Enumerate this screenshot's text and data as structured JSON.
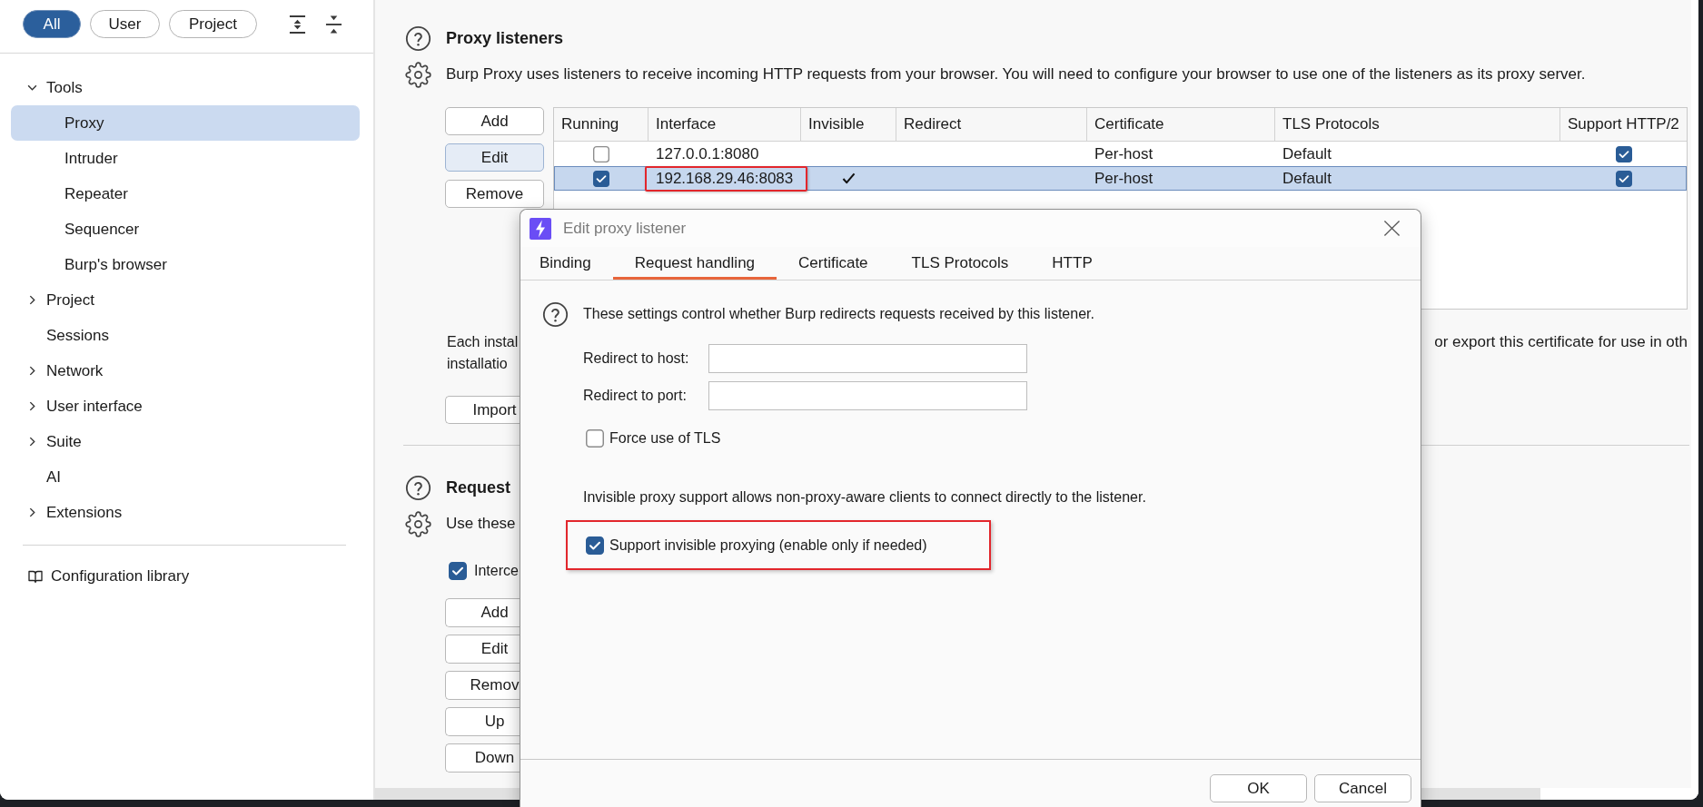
{
  "sidebar": {
    "filters": [
      {
        "label": "All",
        "selected": true
      },
      {
        "label": "User",
        "selected": false
      },
      {
        "label": "Project",
        "selected": false
      }
    ],
    "tree": [
      {
        "label": "Tools",
        "kind": "folder",
        "expanded": true,
        "selected": false,
        "children": [
          {
            "label": "Proxy",
            "selected": true
          },
          {
            "label": "Intruder",
            "selected": false
          },
          {
            "label": "Repeater",
            "selected": false
          },
          {
            "label": "Sequencer",
            "selected": false
          },
          {
            "label": "Burp's browser",
            "selected": false
          }
        ]
      },
      {
        "label": "Project",
        "kind": "folder",
        "expanded": false,
        "selected": false
      },
      {
        "label": "Sessions",
        "kind": "leaf",
        "selected": false
      },
      {
        "label": "Network",
        "kind": "folder",
        "expanded": false,
        "selected": false
      },
      {
        "label": "User interface",
        "kind": "folder",
        "expanded": false,
        "selected": false
      },
      {
        "label": "Suite",
        "kind": "folder",
        "expanded": false,
        "selected": false
      },
      {
        "label": "AI",
        "kind": "leaf",
        "selected": false
      },
      {
        "label": "Extensions",
        "kind": "folder",
        "expanded": false,
        "selected": false
      }
    ],
    "footer_link": "Configuration library"
  },
  "proxy_listeners": {
    "title": "Proxy listeners",
    "description": "Burp Proxy uses listeners to receive incoming HTTP requests from your browser. You will need to configure your browser to use one of the listeners as its proxy server.",
    "buttons": [
      {
        "label": "Add",
        "focused": false
      },
      {
        "label": "Edit",
        "focused": true
      },
      {
        "label": "Remove",
        "focused": false
      }
    ],
    "table": {
      "columns": [
        "Running",
        "Interface",
        "Invisible",
        "Redirect",
        "Certificate",
        "TLS Protocols",
        "Support HTTP/2"
      ],
      "rows": [
        {
          "running": false,
          "interface": "127.0.0.1:8080",
          "invisible": false,
          "certificate": "Per-host",
          "tls_protocols": "Default",
          "support_http2": true,
          "selected": false,
          "highlighted": false
        },
        {
          "running": true,
          "interface": "192.168.29.46:8083",
          "invisible": true,
          "certificate": "Per-host",
          "tls_protocols": "Default",
          "support_http2": true,
          "selected": true,
          "highlighted": true
        }
      ]
    }
  },
  "certificate_section": {
    "lines": [
      {
        "left": "Each instal",
        "right": "or export this certificate for use in oth"
      },
      {
        "left": "installatio"
      }
    ],
    "buttons": [
      "Import"
    ]
  },
  "request_section": {
    "title": "Request",
    "description": "Use these",
    "checkbox": {
      "label": "Interce",
      "checked": true
    },
    "buttons": [
      "Add",
      "Edit",
      "Remov",
      "Up",
      "Down"
    ]
  },
  "dialog": {
    "title": "Edit proxy listener",
    "tabs": [
      {
        "label": "Binding",
        "selected": false
      },
      {
        "label": "Request handling",
        "selected": true
      },
      {
        "label": "Certificate",
        "selected": false
      },
      {
        "label": "TLS Protocols",
        "selected": false
      },
      {
        "label": "HTTP",
        "selected": false
      }
    ],
    "intro": "These settings control whether Burp redirects requests received by this listener.",
    "fields": [
      {
        "label": "Redirect to host:"
      },
      {
        "label": "Redirect to port:"
      }
    ],
    "force_tls": {
      "label": "Force use of TLS",
      "checked": false
    },
    "invisible_note": "Invisible proxy support allows non-proxy-aware clients to connect directly to the listener.",
    "invisible_support": {
      "label": "Support invisible proxying (enable only if needed)",
      "checked": true,
      "highlighted": true
    },
    "buttons": [
      "OK",
      "Cancel"
    ]
  }
}
